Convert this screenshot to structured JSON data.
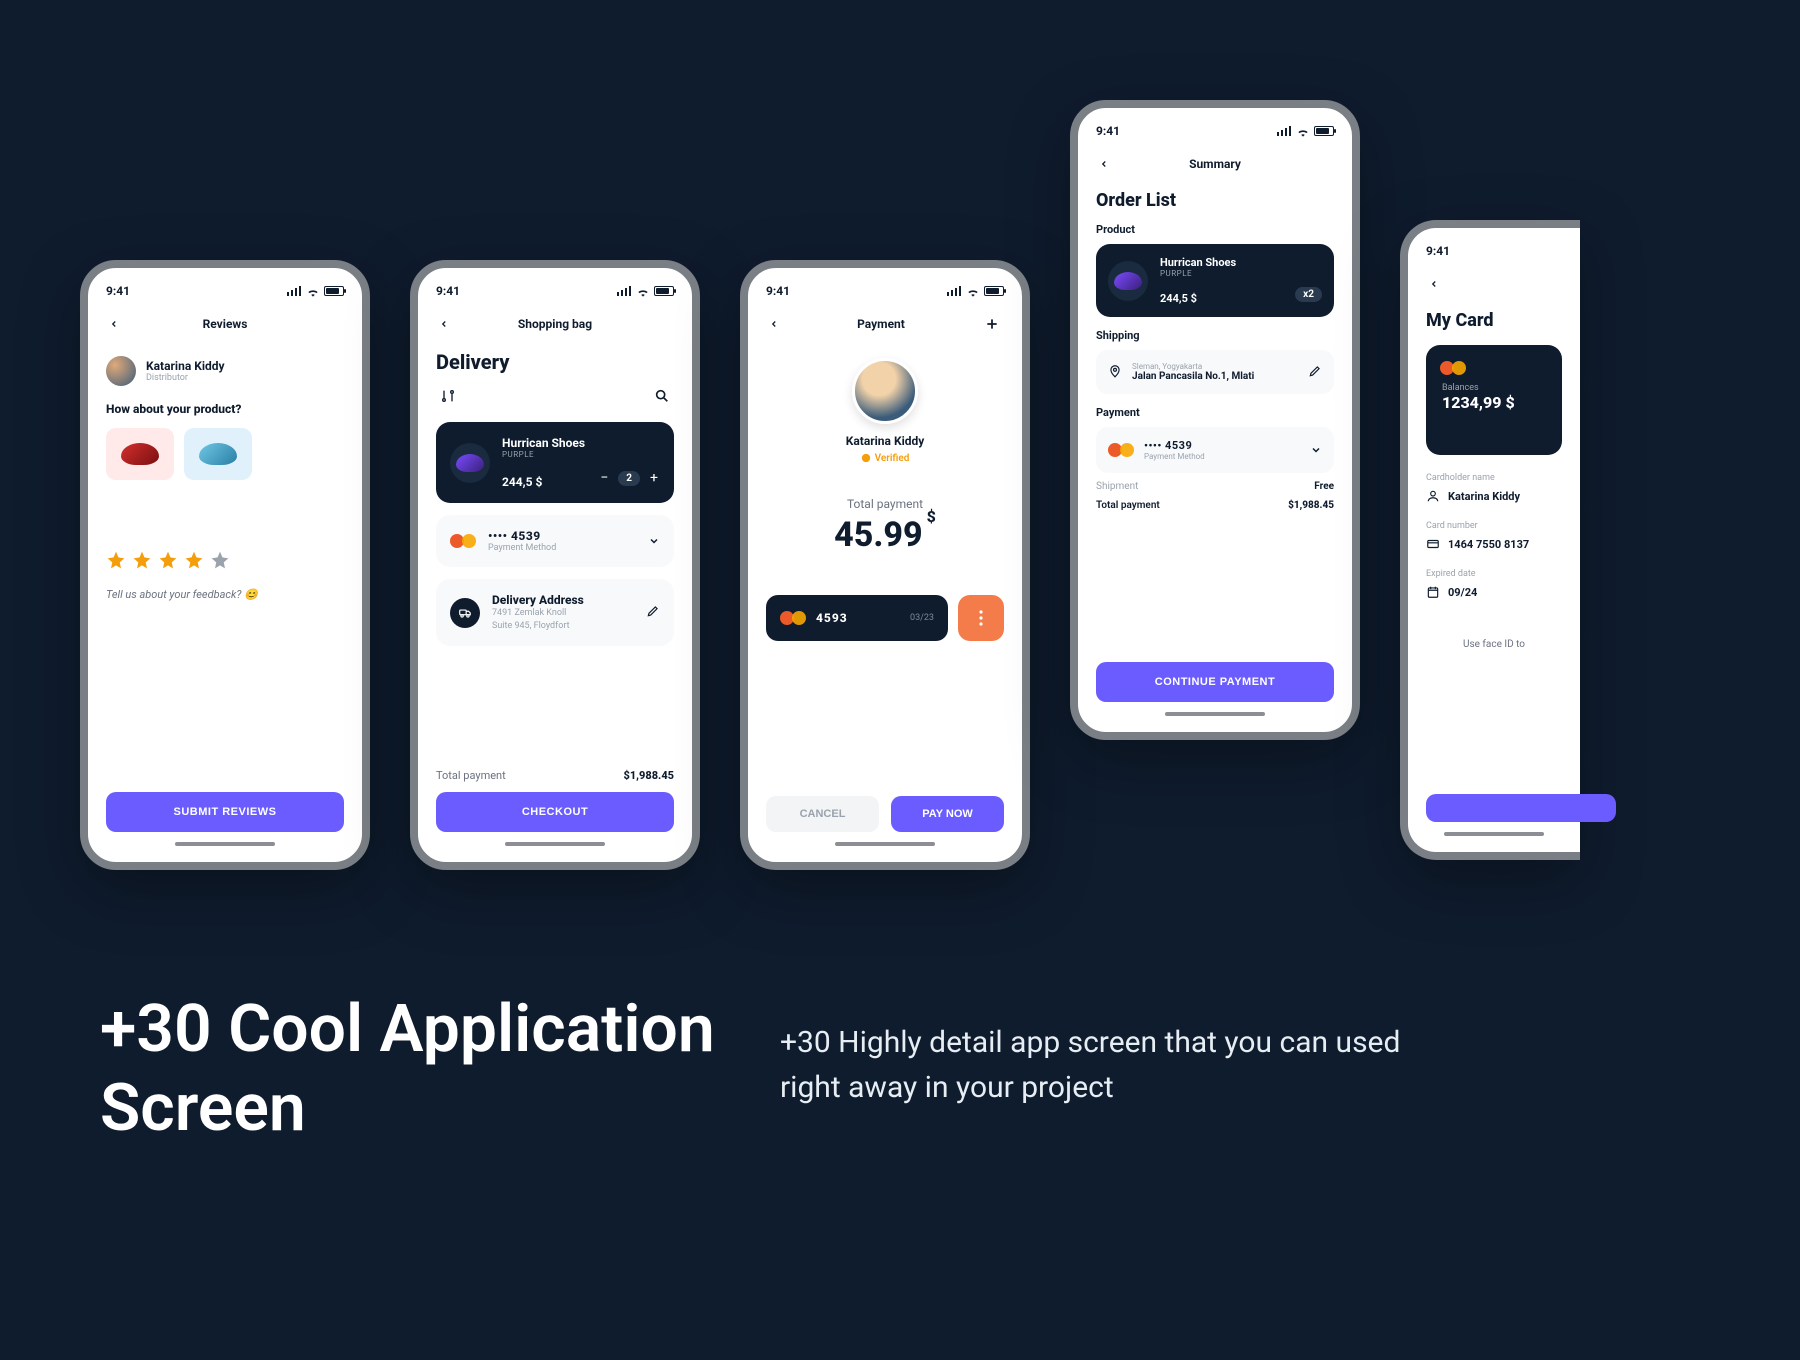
{
  "status": {
    "time": "9:41"
  },
  "screen1": {
    "title": "Reviews",
    "user": {
      "name": "Katarina Kiddy",
      "role": "Distributor"
    },
    "question": "How about your product?",
    "feedback": "Tell us about your feedback? 😊",
    "submit": "SUBMIT REVIEWS",
    "rating": 4
  },
  "screen2": {
    "title": "Shopping bag",
    "heading": "Delivery",
    "product": {
      "name": "Hurrican Shoes",
      "variant": "PURPLE",
      "price": "244,5 $",
      "qty": "2"
    },
    "payment": {
      "last4": "•••• 4539",
      "sub": "Payment Method"
    },
    "address": {
      "title": "Delivery Address",
      "line1": "7491 Zemlak Knoll",
      "line2": "Suite 945, Floydfort"
    },
    "total": {
      "label": "Total payment",
      "value": "$1,988.45"
    },
    "checkout": "CHECKOUT"
  },
  "screen3": {
    "title": "Payment",
    "user": "Katarina Kiddy",
    "verified": "Verified",
    "tp_label": "Total payment",
    "amount": "45.99",
    "currency": "$",
    "card": {
      "last4": "4593",
      "exp": "03/23"
    },
    "cancel": "CANCEL",
    "pay": "PAY NOW"
  },
  "screen4": {
    "title": "Summary",
    "heading": "Order List",
    "section_product": "Product",
    "product": {
      "name": "Hurrican Shoes",
      "variant": "PURPLE",
      "price": "244,5 $",
      "qty": "x2"
    },
    "section_shipping": "Shipping",
    "shipping": {
      "region": "Sleman, Yogyakarta",
      "address": "Jalan Pancasila No.1, Mlati"
    },
    "section_payment": "Payment",
    "payment": {
      "last4": "•••• 4539",
      "sub": "Payment Method"
    },
    "rows": [
      {
        "lab": "Shipment",
        "val": "Free"
      },
      {
        "lab": "Total payment",
        "val": "$1,988.45"
      }
    ],
    "continue": "CONTINUE PAYMENT"
  },
  "screen5": {
    "heading": "My Card",
    "balance_label": "Balances",
    "balance": "1234,99 $",
    "fields": {
      "holder_label": "Cardholder name",
      "holder": "Katarina Kiddy",
      "num_label": "Card number",
      "num": "1464 7550 8137",
      "exp_label": "Expired date",
      "exp": "09/24"
    },
    "faceid": "Use face ID to"
  },
  "marketing": {
    "headline": "+30 Cool Application Screen",
    "subline": "+30 Highly detail app screen that you can used right away in your project"
  }
}
